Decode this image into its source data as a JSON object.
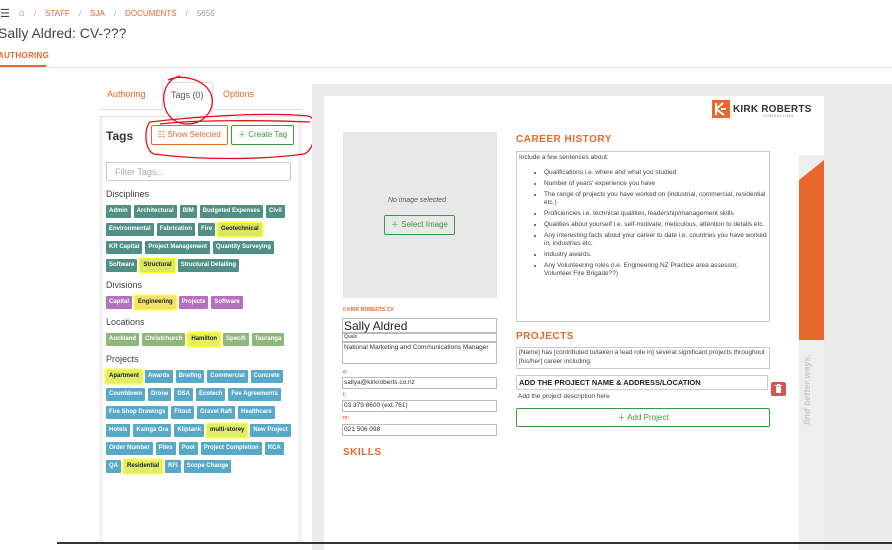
{
  "breadcrumb": {
    "menu_icon": "hamburger-icon",
    "home_icon": "home-icon",
    "items": [
      "STAFF",
      "SJA",
      "DOCUMENTS",
      "5655"
    ]
  },
  "page": {
    "title": "Sally Aldred: CV-???",
    "tab": "AUTHORING"
  },
  "panel": {
    "tabs": [
      "Authoring",
      "Tags (0)",
      "Options"
    ],
    "tags_heading": "Tags",
    "show_selected": "Show Selected",
    "create_tag": "Create Tag",
    "filter_placeholder": "Filter Tags..."
  },
  "tag_groups": [
    {
      "title": "Disciplines",
      "color": "#4f8f86",
      "tags": [
        {
          "label": "Admin"
        },
        {
          "label": "Architectural"
        },
        {
          "label": "BIM"
        },
        {
          "label": "Budgeted Expenses"
        },
        {
          "label": "Civil"
        },
        {
          "label": "Environmental"
        },
        {
          "label": "Fabrication"
        },
        {
          "label": "Fire"
        },
        {
          "label": "Geotechnical",
          "highlighted": true
        },
        {
          "label": "KR Capital"
        },
        {
          "label": "Project Management"
        },
        {
          "label": "Quantity Surveying"
        },
        {
          "label": "Software"
        },
        {
          "label": "Structural",
          "highlighted": true
        },
        {
          "label": "Structural Detailing"
        }
      ]
    },
    {
      "title": "Divisions",
      "color": "#b66ec0",
      "tags": [
        {
          "label": "Capital"
        },
        {
          "label": "Engineering",
          "highlighted": true
        },
        {
          "label": "Projects"
        },
        {
          "label": "Software"
        }
      ]
    },
    {
      "title": "Locations",
      "color": "#8db87a",
      "tags": [
        {
          "label": "Auckland"
        },
        {
          "label": "Christchurch"
        },
        {
          "label": "Hamilton",
          "highlighted": true
        },
        {
          "label": "Specifi"
        },
        {
          "label": "Tauranga"
        }
      ]
    },
    {
      "title": "Projects",
      "color": "#58a8c8",
      "tags": [
        {
          "label": "Apartment",
          "highlighted": true
        },
        {
          "label": "Awards"
        },
        {
          "label": "Briefing"
        },
        {
          "label": "Commercial"
        },
        {
          "label": "Concrete"
        },
        {
          "label": "Countdown"
        },
        {
          "label": "Drone"
        },
        {
          "label": "DSA"
        },
        {
          "label": "Ecotech"
        },
        {
          "label": "Fee Agreements"
        },
        {
          "label": "Fire Shop Drawings"
        },
        {
          "label": "Fitout"
        },
        {
          "label": "Gravel Raft"
        },
        {
          "label": "Healthcare"
        },
        {
          "label": "Hotels"
        },
        {
          "label": "Kainga Ora"
        },
        {
          "label": "Kliptank"
        },
        {
          "label": "multi-storey",
          "highlighted": true
        },
        {
          "label": "New Project"
        },
        {
          "label": "Order Number"
        },
        {
          "label": "Piles"
        },
        {
          "label": "Pool"
        },
        {
          "label": "Project Completion"
        },
        {
          "label": "RCA"
        },
        {
          "label": "QA"
        },
        {
          "label": "Residential",
          "highlighted": true
        },
        {
          "label": "RFI"
        },
        {
          "label": "Scope Change"
        }
      ]
    }
  ],
  "logo": {
    "text": "KIRK ROBERTS",
    "sub": "CONSULTING"
  },
  "cv": {
    "no_image": "No image selected",
    "select_image": "Select Image",
    "label": "// KIRK ROBERTS CV",
    "name": "Sally Aldred",
    "quals": "Quals",
    "role": "National Marketing and Communications Manager",
    "email_label": "e:",
    "email": "sallya@kirkroberts.co.nz",
    "phone_label": "t:",
    "phone": "03 379 8600 (ext.761)",
    "mobile_label": "m:",
    "mobile": "021 506 098",
    "skills_heading": "SKILLS",
    "career_heading": "CAREER HISTORY",
    "career_intro": "Include a few sentences about:",
    "career_points": [
      "Qualifications i.e. where and what you studied",
      "Number of years' experience you have",
      "The range of projects you have worked on (industrial, commercial, residential etc.)",
      "Proficiencies i.e. technical qualities, leadership/management skills",
      "Qualities about yourself i.e. self-motivate, meticulous, attention to details etc.",
      "Any interesting facts about your career to date i.e. countries you have worked in, industries etc.",
      "Industry awards.",
      "Any Volunteering roles (i.e. Engineering NZ Practice area assessor, Volunteer Fire Brigade??)"
    ],
    "projects_heading": "PROJECTS",
    "projects_intro": "[Name] has [contributed to/taken a lead role in] several significant projects throughout [his/her] career including:",
    "project_name": "ADD THE PROJECT NAME & ADDRESS/LOCATION",
    "project_desc": "Add the project description here",
    "add_project": "Add Project",
    "tagline": "find better ways."
  },
  "colors": {
    "accent": "#e8672c",
    "success": "#3a9a3a",
    "danger": "#d9534f",
    "annotation": "#e0101a",
    "highlight": "#ffff33"
  }
}
